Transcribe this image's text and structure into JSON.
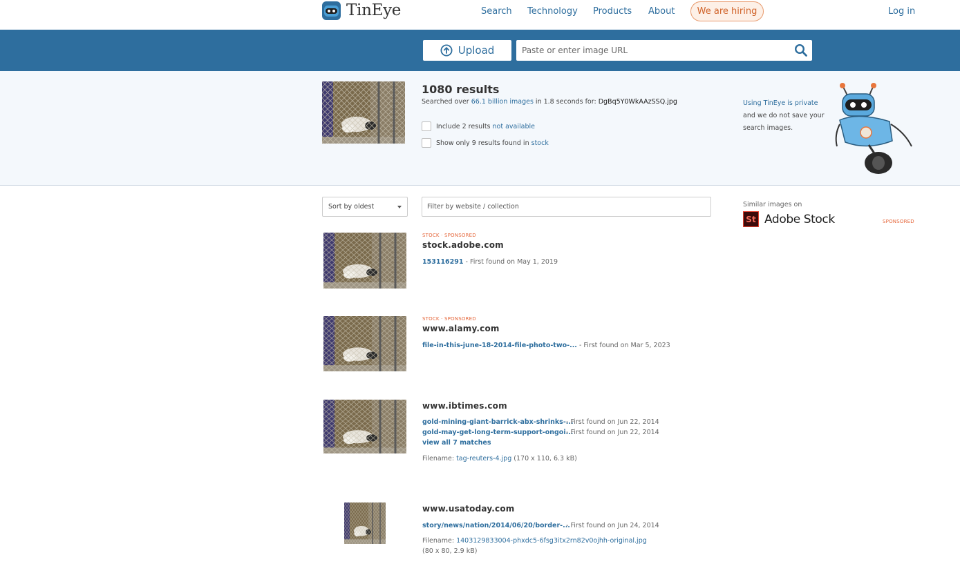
{
  "header": {
    "brand": "TinEye",
    "nav": [
      "Search",
      "Technology",
      "Products",
      "About"
    ],
    "hiring": "We are hiring",
    "login": "Log in"
  },
  "search": {
    "upload_label": "Upload",
    "url_placeholder": "Paste or enter image URL"
  },
  "summary": {
    "count": "1080 results",
    "searched_prefix": "Searched over ",
    "images_link": "66.1 billion images",
    "searched_middle": " in 1.8 seconds for: ",
    "filename": "DgBq5Y0WkAAzSSQ.jpg",
    "include_prefix": "Include 2 results ",
    "include_link": "not available",
    "stock_prefix": "Show only 9 results found in ",
    "stock_link": "stock",
    "privacy_link": "Using TinEye is private",
    "privacy_text": "and we do not save your search images."
  },
  "toolbar": {
    "sort": "Sort by oldest",
    "filter_placeholder": "Filter by website / collection"
  },
  "sidebar": {
    "similar_label": "Similar images on",
    "adobe_badge": "St",
    "adobe_name": "Adobe Stock",
    "sponsored": "SPONSORED"
  },
  "results": [
    {
      "tag": "STOCK · SPONSORED",
      "domain": "stock.adobe.com",
      "matches": [
        {
          "link": "153116291",
          "found": " - First found on May 1, 2019"
        }
      ]
    },
    {
      "tag": "STOCK · SPONSORED",
      "domain": "www.alamy.com",
      "matches": [
        {
          "link": "file-in-this-june-18-2014-file-photo-two-...",
          "found": " - First found on Mar 5, 2023"
        }
      ]
    },
    {
      "tag": "",
      "domain": "www.ibtimes.com",
      "matches": [
        {
          "link": "gold-mining-giant-barrick-abx-shrinks-...",
          "found": " - First found on Jun 22, 2014"
        },
        {
          "link": "gold-may-get-long-term-support-ongoi...",
          "found": " - First found on Jun 22, 2014"
        }
      ],
      "view_all": "view all 7 matches",
      "filename_label": "Filename: ",
      "filename": "tag-reuters-4.jpg",
      "filename_meta": " (170 x 110, 6.3 kB)"
    },
    {
      "tag": "",
      "domain": "www.usatoday.com",
      "matches": [
        {
          "link": "story/news/nation/2014/06/20/border-...",
          "found": " - First found on Jun 24, 2014"
        }
      ],
      "filename_label": "Filename: ",
      "filename": "1403129833004-phxdc5-6fsg3itx2rn82v0ojhh-original.jpg",
      "filename_meta": "(80 x 80, 2.9 kB)"
    }
  ],
  "colors": {
    "brand_blue": "#2e6e9e",
    "accent_orange": "#e5663a",
    "panel_bg": "#f4f8fc"
  }
}
